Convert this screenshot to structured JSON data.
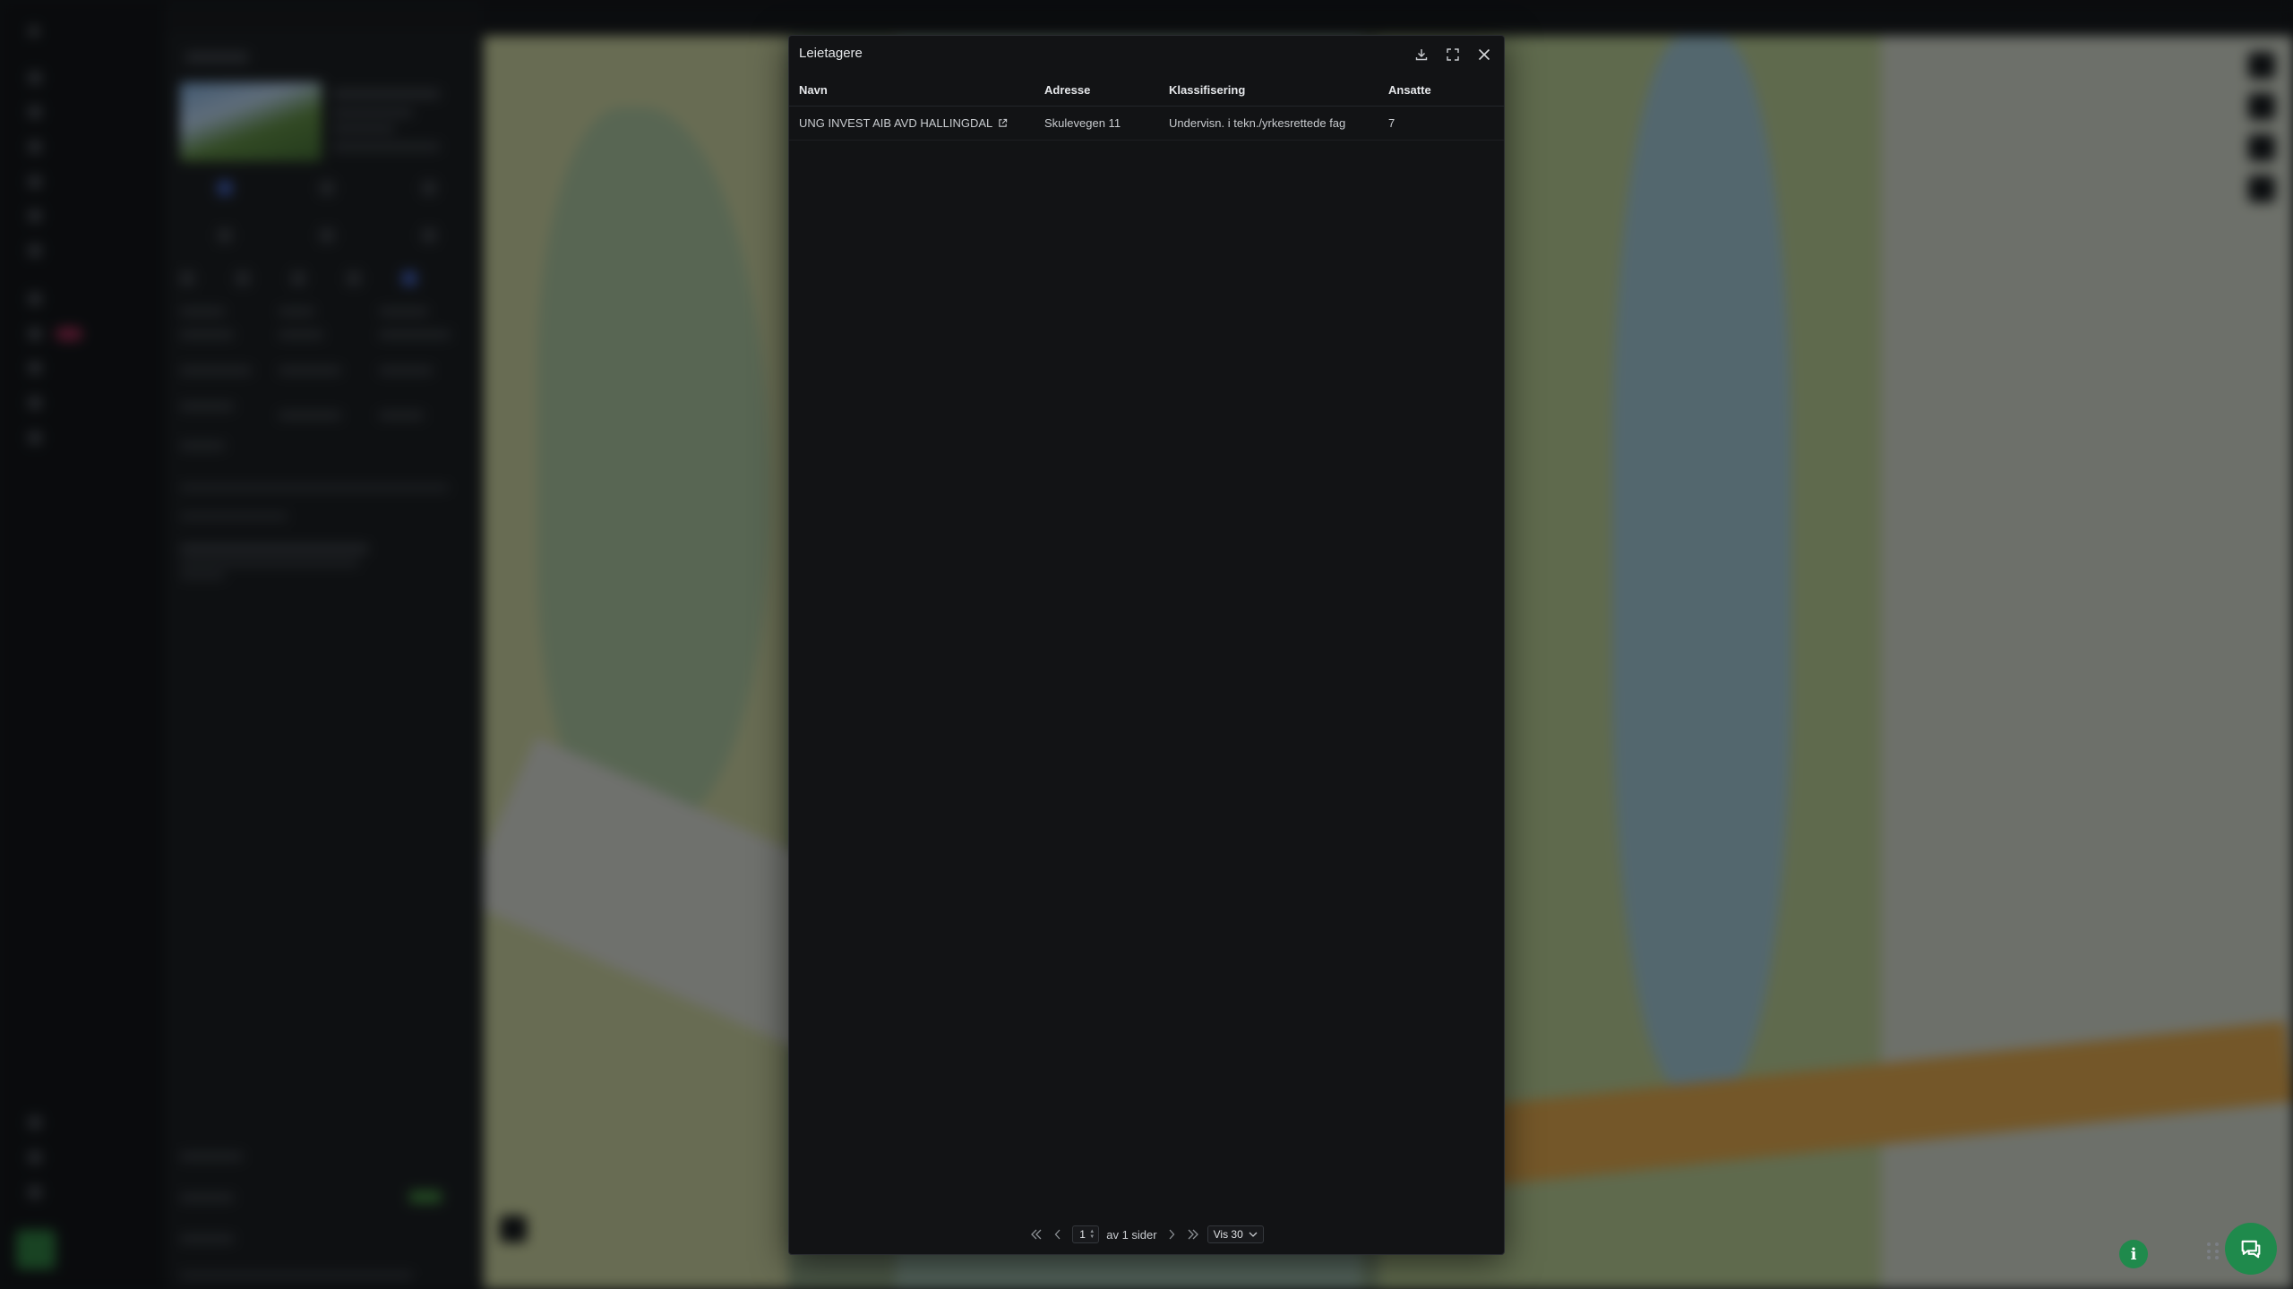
{
  "modal": {
    "title": "Leietagere",
    "columns": [
      "Navn",
      "Adresse",
      "Klassifisering",
      "Ansatte"
    ],
    "rows": [
      {
        "name": "UNG INVEST AIB AVD HALLINGDAL",
        "address": "Skulevegen 11",
        "classification": "Undervisn. i tekn./yrkesrettede fag",
        "employees": "7"
      }
    ],
    "pagination": {
      "current_page": "1",
      "total_text": "av 1 sider",
      "per_page": "Vis 30"
    },
    "actions": [
      "download-icon",
      "expand-icon",
      "close-icon"
    ]
  },
  "floating": {
    "info_label": "i",
    "accent": "#1f8a4c"
  }
}
